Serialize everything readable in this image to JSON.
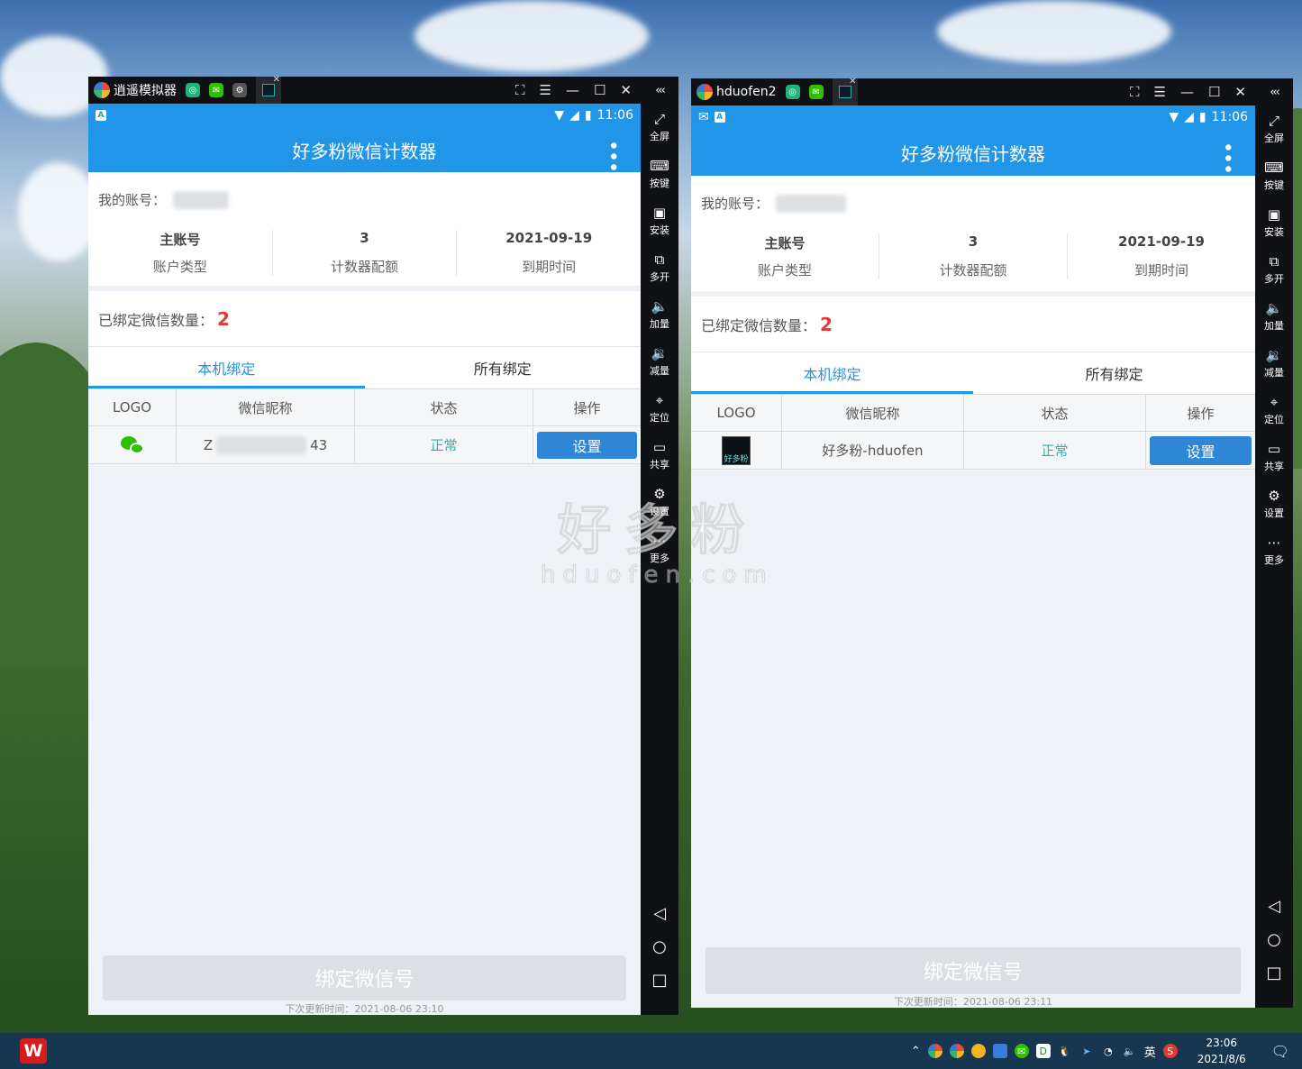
{
  "watermark": {
    "cn": "好多粉",
    "en": "hduofen.com"
  },
  "sidebar": {
    "collapse": "‹‹‹",
    "items": [
      {
        "label": "全屏",
        "glyph": "⤢",
        "icon": "fullscreen-icon"
      },
      {
        "label": "按键",
        "glyph": "⌨",
        "icon": "keyboard-icon"
      },
      {
        "label": "安装",
        "glyph": "▣",
        "icon": "apk-icon"
      },
      {
        "label": "多开",
        "glyph": "⧉",
        "icon": "multi-open-icon"
      },
      {
        "label": "加量",
        "glyph": "🔈",
        "icon": "volume-up-icon"
      },
      {
        "label": "减量",
        "glyph": "🔉",
        "icon": "volume-down-icon"
      },
      {
        "label": "定位",
        "glyph": "⌖",
        "icon": "location-icon"
      },
      {
        "label": "共享",
        "glyph": "▭",
        "icon": "folder-icon"
      },
      {
        "label": "设置",
        "glyph": "⚙",
        "icon": "gear-icon"
      },
      {
        "label": "更多",
        "glyph": "⋯",
        "icon": "more-icon"
      }
    ],
    "nav": {
      "back": "◁",
      "home": "○",
      "recent": "□"
    }
  },
  "win1": {
    "title": "逍遥模拟器",
    "time": "11:06",
    "app_title": "好多粉微信计数器",
    "account_label": "我的账号：",
    "stats": [
      {
        "value": "主账号",
        "label": "账户类型"
      },
      {
        "value": "3",
        "label": "计数器配额"
      },
      {
        "value": "2021-09-19",
        "label": "到期时间"
      }
    ],
    "bound_label": "已绑定微信数量：",
    "bound_count": "2",
    "tabs": [
      "本机绑定",
      "所有绑定"
    ],
    "columns": [
      "LOGO",
      "微信昵称",
      "状态",
      "操作"
    ],
    "row": {
      "nick_start": "Z",
      "nick_end": "43",
      "status": "正常",
      "action": "设置"
    },
    "bind_button": "绑定微信号",
    "update_text": "下次更新时间：2021-08-06 23:10"
  },
  "win2": {
    "title": "hduofen2",
    "time": "11:06",
    "app_title": "好多粉微信计数器",
    "account_label": "我的账号：",
    "stats": [
      {
        "value": "主账号",
        "label": "账户类型"
      },
      {
        "value": "3",
        "label": "计数器配额"
      },
      {
        "value": "2021-09-19",
        "label": "到期时间"
      }
    ],
    "bound_label": "已绑定微信数量：",
    "bound_count": "2",
    "tabs": [
      "本机绑定",
      "所有绑定"
    ],
    "columns": [
      "LOGO",
      "微信昵称",
      "状态",
      "操作"
    ],
    "row": {
      "logo_text": "好多粉",
      "nick": "好多粉-hduofen",
      "status": "正常",
      "action": "设置"
    },
    "bind_button": "绑定微信号",
    "update_text": "下次更新时间：2021-08-06 23:11"
  },
  "taskbar": {
    "ime": "英",
    "time": "23:06",
    "date": "2021/8/6"
  }
}
